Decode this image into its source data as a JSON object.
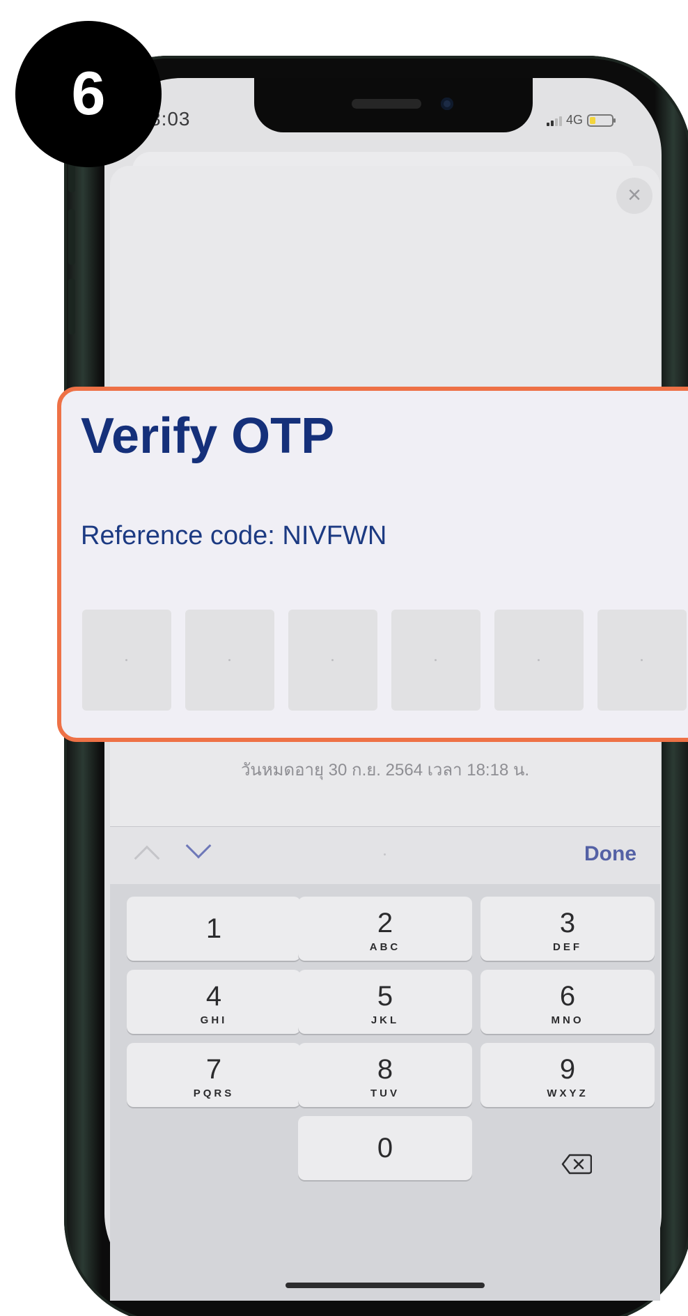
{
  "step": {
    "number": "6"
  },
  "status_bar": {
    "time": "8:03",
    "network": "4G"
  },
  "otp": {
    "title": "Verify OTP",
    "reference": "Reference code: NIVFWN",
    "boxes": [
      "",
      "",
      "",
      "",
      "",
      ""
    ],
    "expiry": "วันหมดอายุ 30 ก.ย. 2564 เวลา 18:18 น."
  },
  "close": {
    "glyph": "×"
  },
  "keyboard": {
    "done_label": "Done",
    "keys": [
      {
        "num": "1",
        "letters": ""
      },
      {
        "num": "2",
        "letters": "ABC"
      },
      {
        "num": "3",
        "letters": "DEF"
      },
      {
        "num": "4",
        "letters": "GHI"
      },
      {
        "num": "5",
        "letters": "JKL"
      },
      {
        "num": "6",
        "letters": "MNO"
      },
      {
        "num": "7",
        "letters": "PQRS"
      },
      {
        "num": "8",
        "letters": "TUV"
      },
      {
        "num": "9",
        "letters": "WXYZ"
      },
      {
        "num": "0",
        "letters": ""
      }
    ]
  },
  "colors": {
    "highlight_border": "#ee7146",
    "title": "#15307a",
    "done": "#5461a5"
  }
}
